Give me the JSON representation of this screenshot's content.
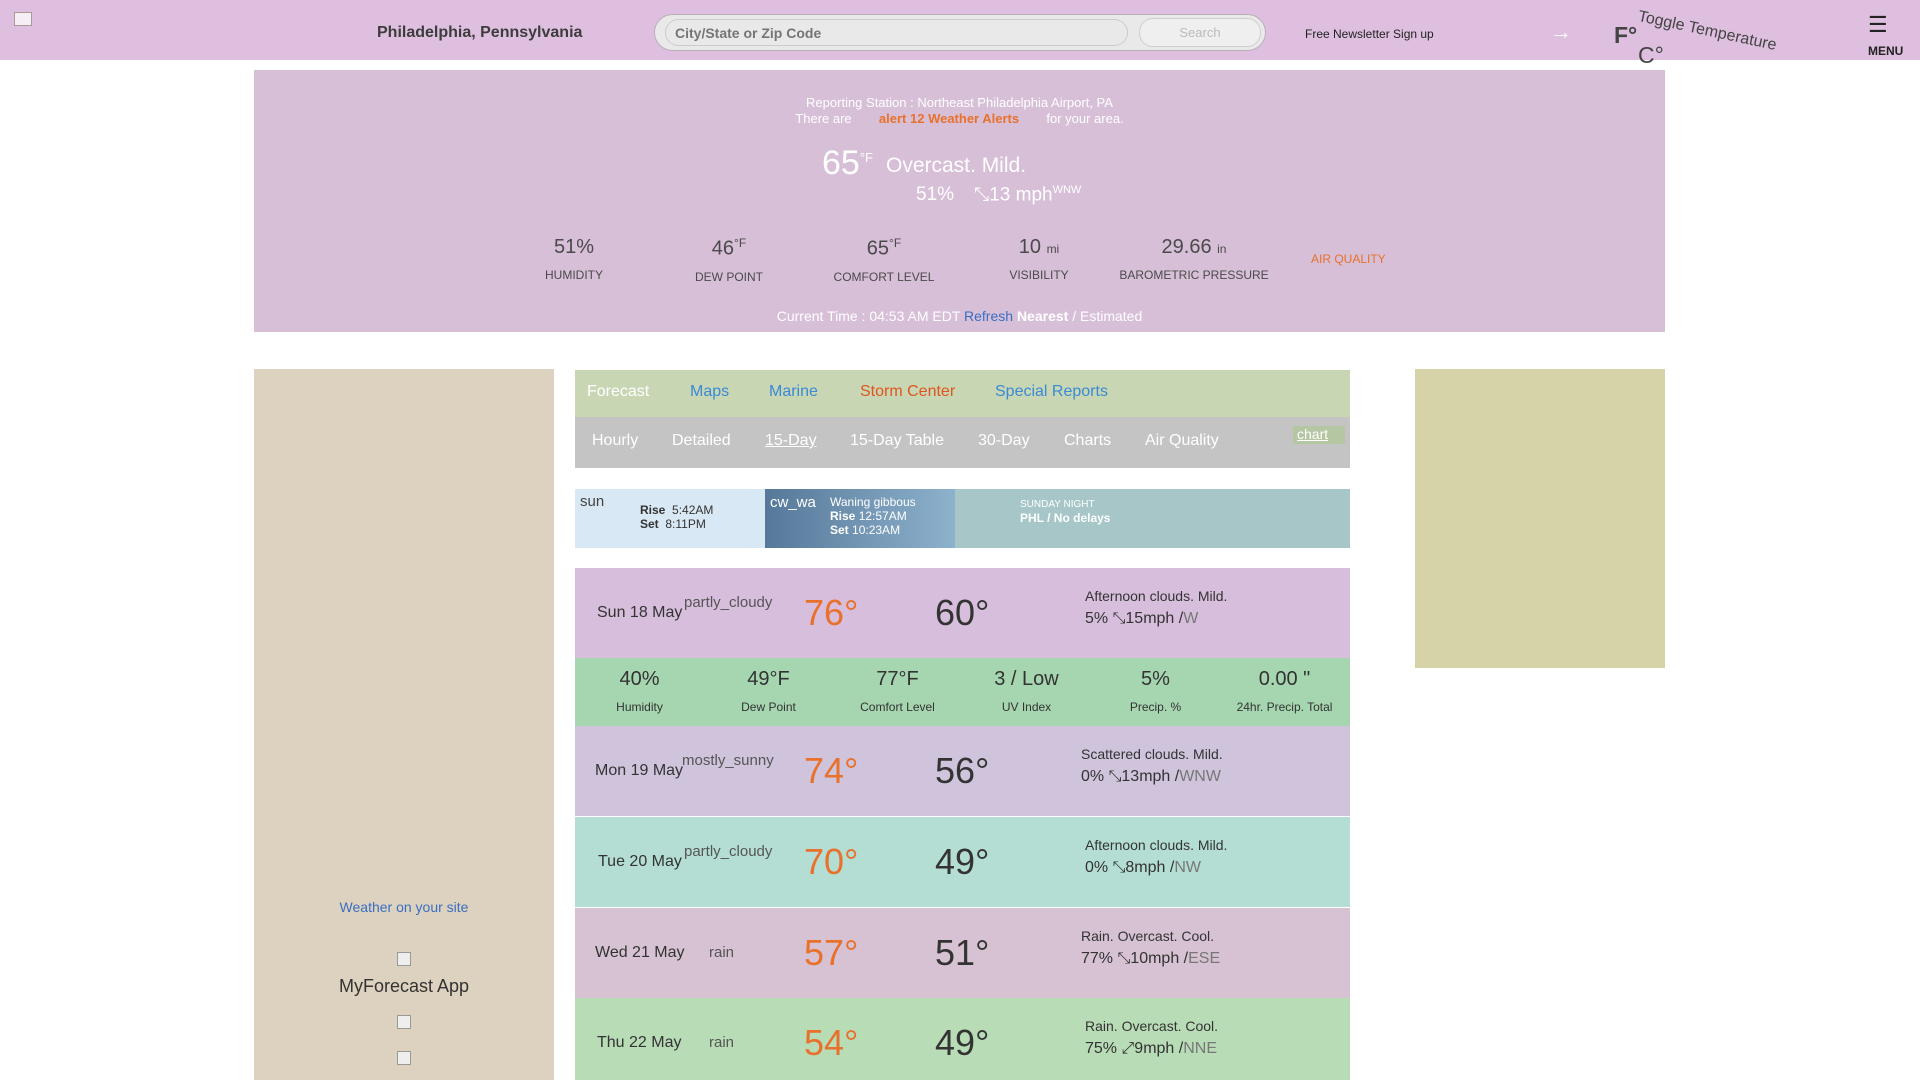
{
  "header": {
    "location": "Philadelphia, Pennsylvania",
    "search_placeholder": "City/State or Zip Code",
    "search_button": "Search",
    "newsletter": "Free Newsletter Sign up",
    "arrow": "→",
    "unit_f": "F°",
    "unit_c": "C°",
    "toggle_alt": "Toggle Temperature",
    "menu_icon": "☰",
    "menu": "MENU"
  },
  "current": {
    "station": "Reporting Station : Northeast Philadelphia Airport, PA",
    "alerts_prefix": "There are",
    "alerts_link": "alert 12 Weather Alerts",
    "alerts_suffix": "for your area.",
    "temp": "65",
    "temp_unit": "°F",
    "condition": "Overcast. Mild.",
    "humidity": "51%",
    "wind": "13 mph",
    "wind_dir": "WNW",
    "stats": [
      {
        "value": "51%",
        "unit": "",
        "label": "HUMIDITY"
      },
      {
        "value": "46",
        "unit": "°F",
        "label": "DEW POINT"
      },
      {
        "value": "65",
        "unit": "°F",
        "label": "COMFORT LEVEL"
      },
      {
        "value": "10",
        "unit": "mi",
        "label": "VISIBILITY"
      },
      {
        "value": "29.66",
        "unit": "in",
        "label": "BAROMETRIC PRESSURE"
      }
    ],
    "air_quality": "AIR QUALITY",
    "time_label": "Current Time : 04:53 AM EDT",
    "refresh": "Refresh",
    "nearest": "Nearest",
    "separator": "/",
    "estimated": "Estimated"
  },
  "tabs": [
    {
      "icon": "",
      "label": "Forecast",
      "color": "#ffffff"
    },
    {
      "icon": "",
      "label": "Maps",
      "color": "#3a8ad6"
    },
    {
      "icon": "",
      "label": "Marine",
      "color": "#3a8ad6"
    },
    {
      "icon": "",
      "label": "Storm Center",
      "color": "#e0551e"
    },
    {
      "icon": "",
      "label": "Special Reports",
      "color": "#3a8ad6"
    }
  ],
  "subtabs": [
    "Hourly",
    "Detailed",
    "15-Day",
    "15-Day Table",
    "30-Day",
    "Charts",
    "Air Quality"
  ],
  "chart_alt": "chart",
  "astro": {
    "sun_alt": "sun",
    "rise_label": "Rise",
    "set_label": "Set",
    "sunrise": "5:42AM",
    "sunset": "8:11PM",
    "moon_alt": "cw_wa",
    "moon_phase": "Waning gibbous",
    "moonrise": "12:57AM",
    "moonset": "10:23AM",
    "night_icon": "",
    "night_label": "SUNDAY NIGHT",
    "night_text": "PHL / No delays"
  },
  "forecast": [
    {
      "day": "Sun 18 May",
      "icon": "partly_cloudy",
      "hi": "76°",
      "lo": "60°",
      "desc": "Afternoon clouds. Mild.",
      "precip": "5%",
      "wind": "15mph /",
      "dir": "W",
      "bg": "#d7bedc",
      "chev": ""
    },
    {
      "day": "Mon 19 May",
      "icon": "mostly_sunny",
      "hi": "74°",
      "lo": "56°",
      "desc": "Scattered clouds. Mild.",
      "precip": "0%",
      "wind": "13mph /",
      "dir": "WNW",
      "bg": "#cfc4dc",
      "chev": ""
    },
    {
      "day": "Tue 20 May",
      "icon": "partly_cloudy",
      "hi": "70°",
      "lo": "49°",
      "desc": "Afternoon clouds. Mild.",
      "precip": "0%",
      "wind": "8mph /",
      "dir": "NW",
      "bg": "#b4ded4",
      "chev": ""
    },
    {
      "day": "Wed 21 May",
      "icon": "rain",
      "hi": "57°",
      "lo": "51°",
      "desc": "Rain. Overcast. Cool.",
      "precip": "77%",
      "wind": "10mph /",
      "dir": "ESE",
      "bg": "#d6c2d2",
      "chev": ""
    },
    {
      "day": "Thu 22 May",
      "icon": "rain",
      "hi": "54°",
      "lo": "49°",
      "desc": "Rain. Overcast. Cool.",
      "precip": "75%",
      "wind": "9mph /",
      "dir": "NNE",
      "bg": "#b8dcb6",
      "chev": ""
    }
  ],
  "details": [
    {
      "value": "40%",
      "label": "Humidity"
    },
    {
      "value": "49°F",
      "label": "Dew Point"
    },
    {
      "value": "77°F",
      "label": "Comfort Level"
    },
    {
      "value": "3 / Low",
      "label": "UV Index"
    },
    {
      "value": "5%",
      "label": "Precip. %"
    },
    {
      "value": "0.00 \"",
      "label": "24hr. Precip. Total"
    }
  ],
  "sidebar": {
    "weather_on_site": " Weather on your site",
    "app_name": "MyForecast App"
  },
  "colors": {
    "accent": "#e8712b",
    "link": "#3a6ec2"
  }
}
